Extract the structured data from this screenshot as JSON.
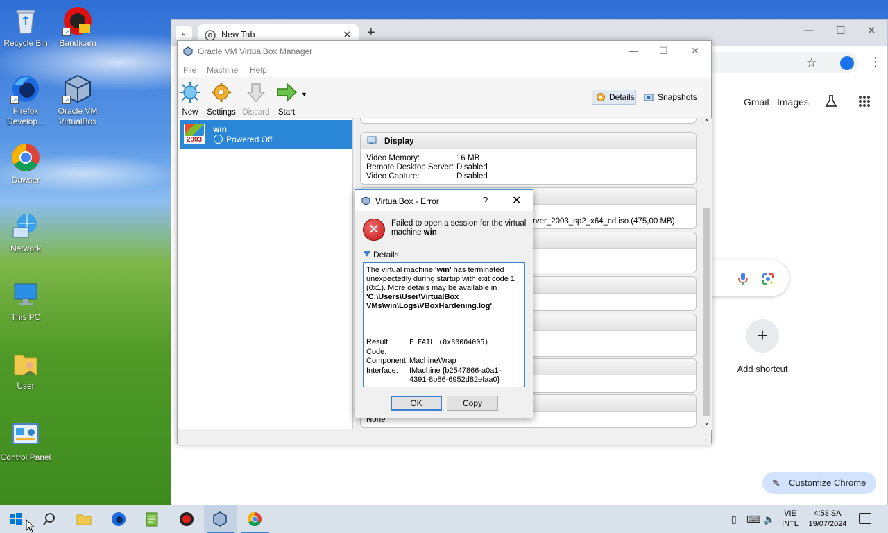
{
  "desktop": {
    "icons": [
      {
        "label": "Recycle Bin"
      },
      {
        "label": "Bandicam"
      },
      {
        "label": "Firefox Develop..."
      },
      {
        "label": "Oracle VM VirtualBox"
      },
      {
        "label": "Dawser"
      },
      {
        "label": "Network"
      },
      {
        "label": "This PC"
      },
      {
        "label": "User"
      },
      {
        "label": "Control Panel"
      }
    ]
  },
  "chrome": {
    "tab_title": "New Tab",
    "links": {
      "gmail": "Gmail",
      "images": "Images"
    },
    "add_shortcut": "Add shortcut",
    "customize": "Customize Chrome"
  },
  "vbox": {
    "title": "Oracle VM VirtualBox Manager",
    "menu": [
      "File",
      "Machine",
      "Help"
    ],
    "toolbar": {
      "new": "New",
      "settings": "Settings",
      "discard": "Discard",
      "start": "Start"
    },
    "details_btn": "Details",
    "snapshots_btn": "Snapshots",
    "vm": {
      "name": "win",
      "state": "Powered Off",
      "os_badge": "2003"
    },
    "display": {
      "title": "Display",
      "rows": [
        {
          "k": "Video Memory:",
          "v": "16 MB"
        },
        {
          "k": "Remote Desktop Server:",
          "v": "Disabled"
        },
        {
          "k": "Video Capture:",
          "v": "Disabled"
        }
      ]
    },
    "storage_partial": "rver_2003_sp2_x64_cd.iso (475,00 MB)",
    "last_value": "None"
  },
  "error": {
    "title": "VirtualBox - Error",
    "help": "?",
    "message_pre": "Failed to open a session for the virtual machine ",
    "message_vm": "win",
    "message_post": ".",
    "details_label": "Details",
    "details": {
      "t1": "The virtual machine ",
      "t2": "'win'",
      "t3": " has terminated unexpectedly during startup with exit code 1 (0x1). More details may be available in ",
      "t4": "'C:\\Users\\User\\VirtualBox VMs\\win\\Logs\\VBoxHardening.log'",
      "t5": "."
    },
    "meta": {
      "result_code_label": "Result Code:",
      "result_code": "E_FAIL (0x80004005)",
      "component_label": "Component:",
      "component": "MachineWrap",
      "interface_label": "Interface:",
      "interface": "IMachine {b2547866-a0a1-4391-8b86-6952d82efaa0}"
    },
    "ok": "OK",
    "copy": "Copy"
  },
  "taskbar": {
    "lang_top": "VIE",
    "lang_bottom": "INTL",
    "time": "4:53 SA",
    "date": "19/07/2024"
  }
}
